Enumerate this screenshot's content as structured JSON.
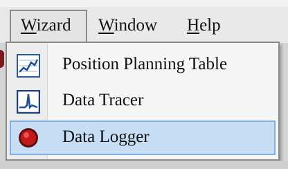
{
  "menubar": {
    "items": [
      {
        "label": "Wizard",
        "mnemonic_underlined": "W"
      },
      {
        "label": "Window",
        "mnemonic_underlined": "W"
      },
      {
        "label": "Help",
        "mnemonic_underlined": "H"
      }
    ],
    "active_item": "Wizard"
  },
  "dropdown": {
    "items": [
      {
        "label": "Position Planning Table",
        "icon": "position-chart-icon"
      },
      {
        "label": "Data Tracer",
        "icon": "waveform-icon"
      },
      {
        "label": "Data Logger",
        "icon": "red-record-icon",
        "highlighted": true
      }
    ]
  },
  "colors": {
    "highlight_bg": "#c7ddf3",
    "highlight_border": "#7fb0e0",
    "menu_bg": "#f5f5f5"
  }
}
